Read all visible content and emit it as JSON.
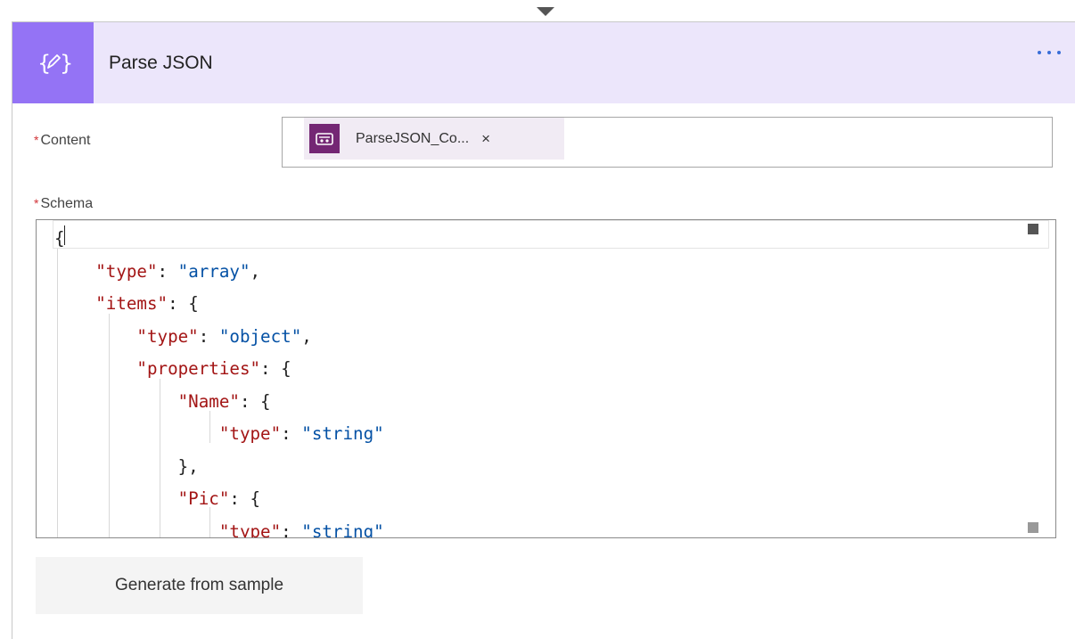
{
  "action": {
    "title": "Parse JSON",
    "icon": "parse-json-icon",
    "more_icon": "more-options-icon"
  },
  "content": {
    "label": "Content",
    "required_marker": "*",
    "token": {
      "label": "ParseJSON_Co...",
      "icon": "powerapps-icon",
      "remove_label": "×"
    }
  },
  "schema": {
    "label": "Schema",
    "required_marker": "*",
    "lines": [
      "{",
      "\"type\": \"array\",",
      "\"items\": {",
      "\"type\": \"object\",",
      "\"properties\": {",
      "\"Name\": {",
      "\"type\": \"string\"",
      "},",
      "\"Pic\": {",
      "\"type\": \"string\""
    ]
  },
  "generate_button": {
    "label": "Generate from sample"
  },
  "colors": {
    "header_bg": "#ece6fb",
    "icon_tile": "#9473f5",
    "token_icon": "#742774",
    "json_key": "#a31515",
    "json_string": "#0451a5",
    "required": "#d13438"
  }
}
